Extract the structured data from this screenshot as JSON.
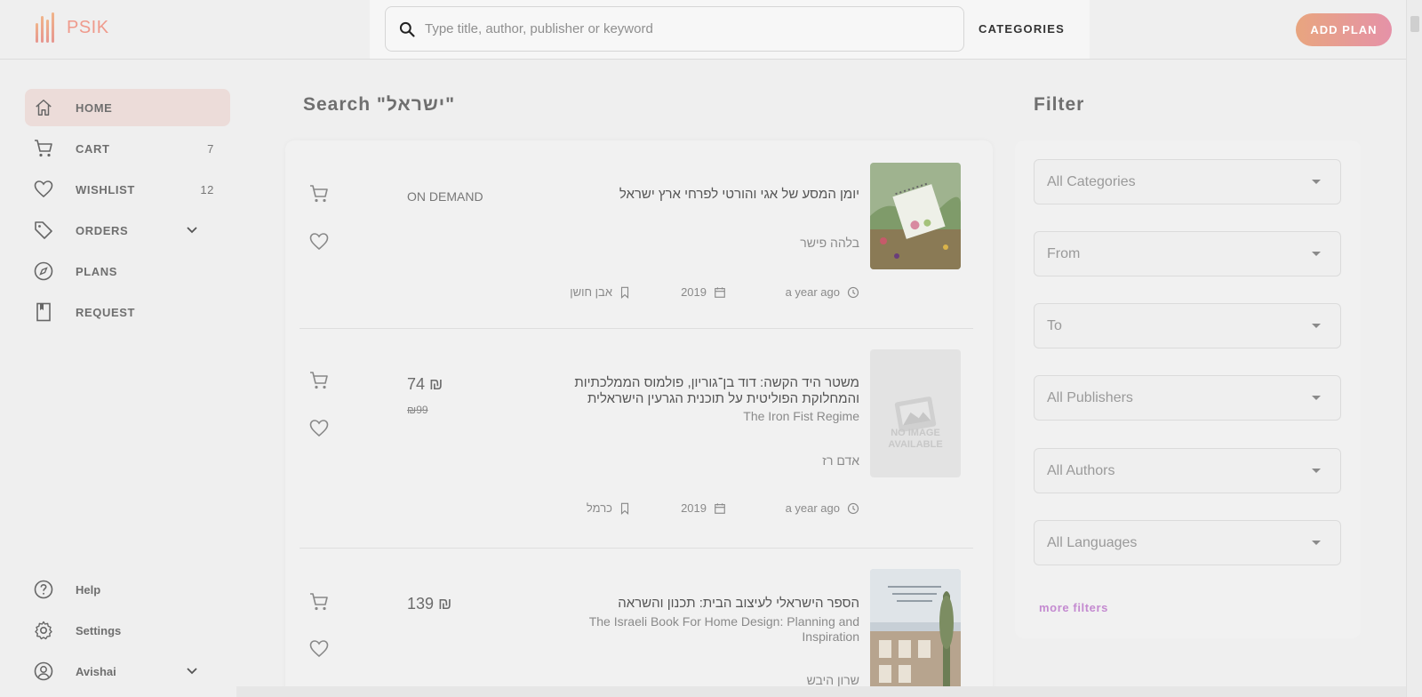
{
  "app": {
    "name": "PSIK"
  },
  "header": {
    "search_placeholder": "Type title, author, publisher or keyword",
    "categories_label": "CATEGORIES",
    "add_plan_label": "ADD PLAN"
  },
  "sidebar": {
    "items": [
      {
        "label": "HOME",
        "icon": "home-icon",
        "active": true
      },
      {
        "label": "CART",
        "icon": "cart-icon",
        "count": "7"
      },
      {
        "label": "WISHLIST",
        "icon": "heart-icon",
        "count": "12"
      },
      {
        "label": "ORDERS",
        "icon": "tag-icon"
      },
      {
        "label": "PLANS",
        "icon": "compass-icon"
      },
      {
        "label": "REQUEST",
        "icon": "book-icon"
      }
    ],
    "bottom": [
      {
        "label": "Help",
        "icon": "help-icon"
      },
      {
        "label": "Settings",
        "icon": "gear-icon"
      },
      {
        "label": "Avishai",
        "icon": "user-icon"
      }
    ]
  },
  "main": {
    "search_title": "Search \"ישראל\"",
    "results": [
      {
        "title": "יומן המסע של אגי והורטי לפרחי ארץ ישראל",
        "author": "בלהה פישר",
        "status": "ON DEMAND",
        "added": "a year ago",
        "year": "2019",
        "publisher": "אבן חושן"
      },
      {
        "title": "משטר היד הקשה: דוד בן־גוריון, פולמוס הממלכתיות והמחלוקת הפוליטית על תוכנית הגרעין הישראלית",
        "subtitle": "The Iron Fist Regime",
        "author": "אדם רז",
        "price": "74 ₪",
        "old_price": "₪99",
        "added": "a year ago",
        "year": "2019",
        "publisher": "כרמל",
        "cover_text_1": "NO IMAGE",
        "cover_text_2": "AVAILABLE"
      },
      {
        "title": "הספר הישראלי לעיצוב הבית: תכנון והשראה",
        "subtitle": "The Israeli Book For Home Design: Planning and Inspiration",
        "author": "שרון היבש",
        "price": "139 ₪"
      }
    ]
  },
  "filter": {
    "title": "Filter",
    "selects": [
      "All Categories",
      "From",
      "To",
      "All Publishers",
      "All Authors",
      "All Languages"
    ],
    "more_filters": "more filters"
  }
}
